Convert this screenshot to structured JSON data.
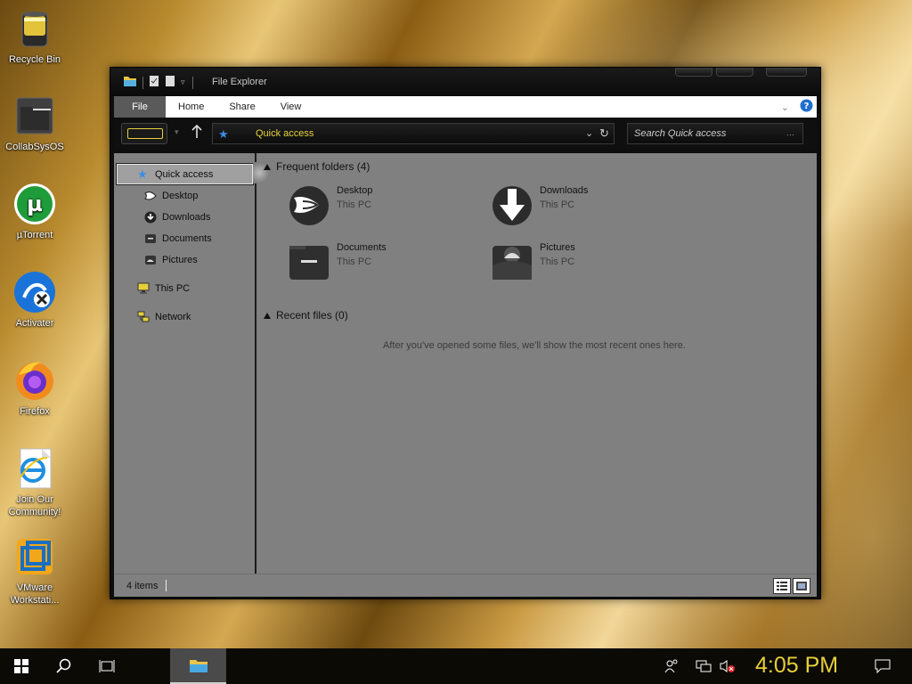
{
  "desktop": {
    "icons": [
      {
        "label": "Recycle Bin"
      },
      {
        "label": "CollabSysOS"
      },
      {
        "label": "µTorrent"
      },
      {
        "label": "Activater"
      },
      {
        "label": "Firefox"
      },
      {
        "label": "Join Our Community!"
      },
      {
        "label": "VMware Workstati..."
      }
    ]
  },
  "window": {
    "title": "File Explorer",
    "ribbon_tabs": [
      "File",
      "Home",
      "Share",
      "View"
    ],
    "address": "Quick access",
    "search_placeholder": "Search Quick access"
  },
  "nav_pane": {
    "items": [
      {
        "label": "Quick access",
        "icon": "star-icon"
      },
      {
        "label": "Desktop",
        "icon": "desktop-icon"
      },
      {
        "label": "Downloads",
        "icon": "download-icon"
      },
      {
        "label": "Documents",
        "icon": "document-icon"
      },
      {
        "label": "Pictures",
        "icon": "picture-icon"
      },
      {
        "label": "This PC",
        "icon": "computer-icon"
      },
      {
        "label": "Network",
        "icon": "network-icon"
      }
    ]
  },
  "main": {
    "frequent_header": "Frequent folders (4)",
    "folders": [
      {
        "name": "Desktop",
        "location": "This PC"
      },
      {
        "name": "Downloads",
        "location": "This PC"
      },
      {
        "name": "Documents",
        "location": "This PC"
      },
      {
        "name": "Pictures",
        "location": "This PC"
      }
    ],
    "recent_header": "Recent files (0)",
    "recent_empty_message": "After you've opened some files, we'll show the most recent ones here."
  },
  "status": {
    "item_count": "4 items"
  },
  "taskbar": {
    "time": "4:05 PM"
  },
  "colors": {
    "accent_yellow": "#e6cf3a",
    "pane_gray": "#808080"
  }
}
